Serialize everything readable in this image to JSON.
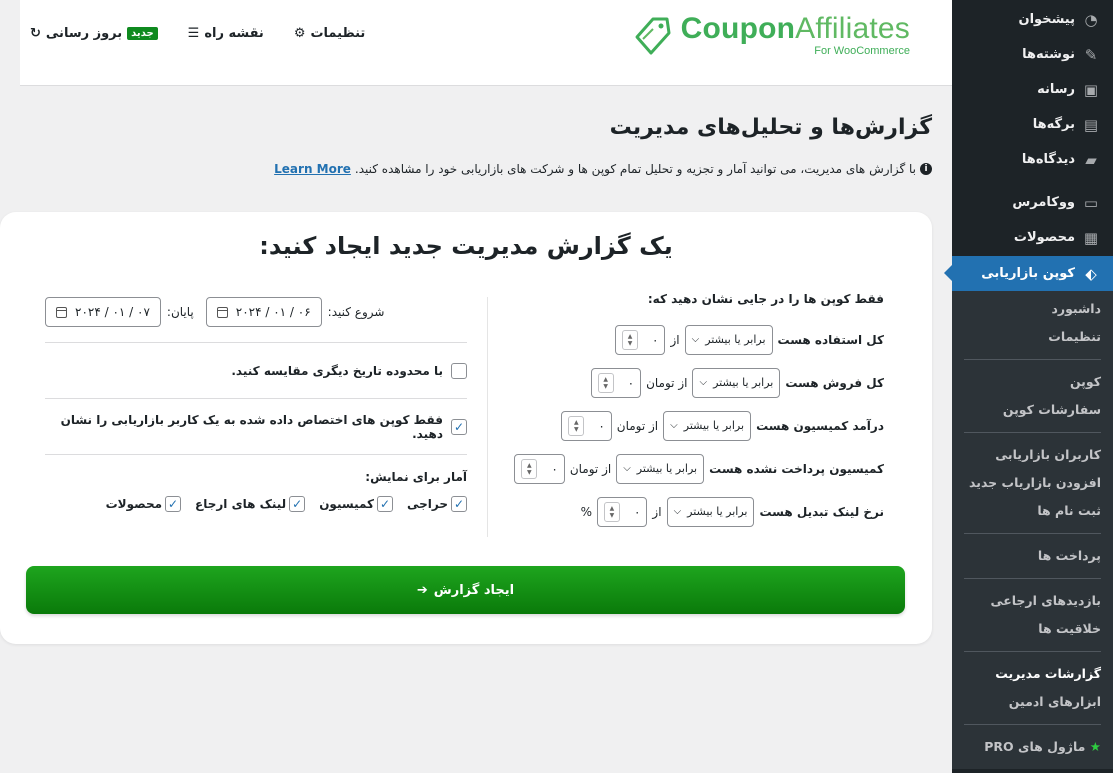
{
  "sidebar": {
    "items_top": [
      {
        "label": "پیشخوان",
        "icon": "dashboard-icon"
      },
      {
        "label": "نوشته‌ها",
        "icon": "pin-icon"
      },
      {
        "label": "رسانه",
        "icon": "media-icon"
      },
      {
        "label": "برگه‌ها",
        "icon": "pages-icon"
      },
      {
        "label": "دیدگاه‌ها",
        "icon": "comments-icon"
      },
      {
        "label": "ووکامرس",
        "icon": "woocommerce-icon"
      },
      {
        "label": "محصولات",
        "icon": "products-icon"
      },
      {
        "label": "کوپن بازاریابی",
        "icon": "tag-icon"
      }
    ],
    "sub_items": {
      "g1": [
        "داشبورد",
        "تنظیمات"
      ],
      "g2": [
        "کوپن",
        "سفارشات کوپن"
      ],
      "g3": [
        "کاربران بازاریابی",
        "افزودن بازاریاب جدید",
        "ثبت نام ها"
      ],
      "g4": [
        "پرداخت ها"
      ],
      "g5": [
        "بازدیدهای ارجاعی",
        "خلاقیت ها"
      ],
      "g6": [
        "گزارشات مدیریت",
        "ابزارهای ادمین"
      ],
      "g7": [
        "ماژول های PRO"
      ]
    }
  },
  "topbar": {
    "logo_main_1": "Coupon",
    "logo_main_2": "Affiliates",
    "logo_sub": "For WooCommerce",
    "nav_settings": "تنظیمات",
    "nav_roadmap": "نقشه راه",
    "nav_updates": "بروز رسانی",
    "nav_new_badge": "جدید"
  },
  "page": {
    "title": "گزارش‌ها و تحلیل‌های مدیریت",
    "description": "با گزارش های مدیریت، می توانید آمار و تجزیه و تحلیل تمام کوپن ها و شرکت های بازاریابی خود را مشاهده کنید.",
    "learn_more": "Learn More"
  },
  "card": {
    "title": "یک گزارش مدیریت جدید ایجاد کنید:",
    "filters_title": "فقط کوپن ها را در جایی نشان دهید که:",
    "filters": [
      {
        "label": "کل استفاده هست",
        "select": "برابر یا بیشتر",
        "unit": "از",
        "value": "۰"
      },
      {
        "label": "کل فروش هست",
        "select": "برابر یا بیشتر",
        "unit": "از تومان",
        "value": "۰"
      },
      {
        "label": "درآمد کمیسیون هست",
        "select": "برابر یا بیشتر",
        "unit": "از تومان",
        "value": "۰"
      },
      {
        "label": "کمیسیون پرداخت نشده هست",
        "select": "برابر یا بیشتر",
        "unit": "از تومان",
        "value": "۰"
      },
      {
        "label": "نرخ لینک تبدیل هست",
        "select": "برابر یا بیشتر",
        "unit": "از",
        "value": "۰",
        "suffix": "%"
      }
    ],
    "start_label": "شروع کنید:",
    "start_date": "۲۰۲۴ / ۰۱ / ۰۶",
    "end_label": "پایان:",
    "end_date": "۲۰۲۴ / ۰۱ / ۰۷",
    "compare_label": "با محدوده تاریخ دیگری مقایسه کنید.",
    "assigned_only_label": "فقط کوپن های اختصاص داده شده به یک کاربر بازاریابی را نشان دهید.",
    "stats_title": "آمار برای نمایش:",
    "stats": [
      {
        "label": "حراجی",
        "checked": true
      },
      {
        "label": "کمیسیون",
        "checked": true
      },
      {
        "label": "لینک های ارجاع",
        "checked": true
      },
      {
        "label": "محصولات",
        "checked": true
      }
    ],
    "create_button": "ایجاد گزارش",
    "create_arrow": "➔"
  },
  "colors": {
    "sidebar_bg": "#1d2327",
    "active_bg": "#2271b1",
    "brand_green": "#3fae58",
    "button_green": "#0f8a1f"
  }
}
